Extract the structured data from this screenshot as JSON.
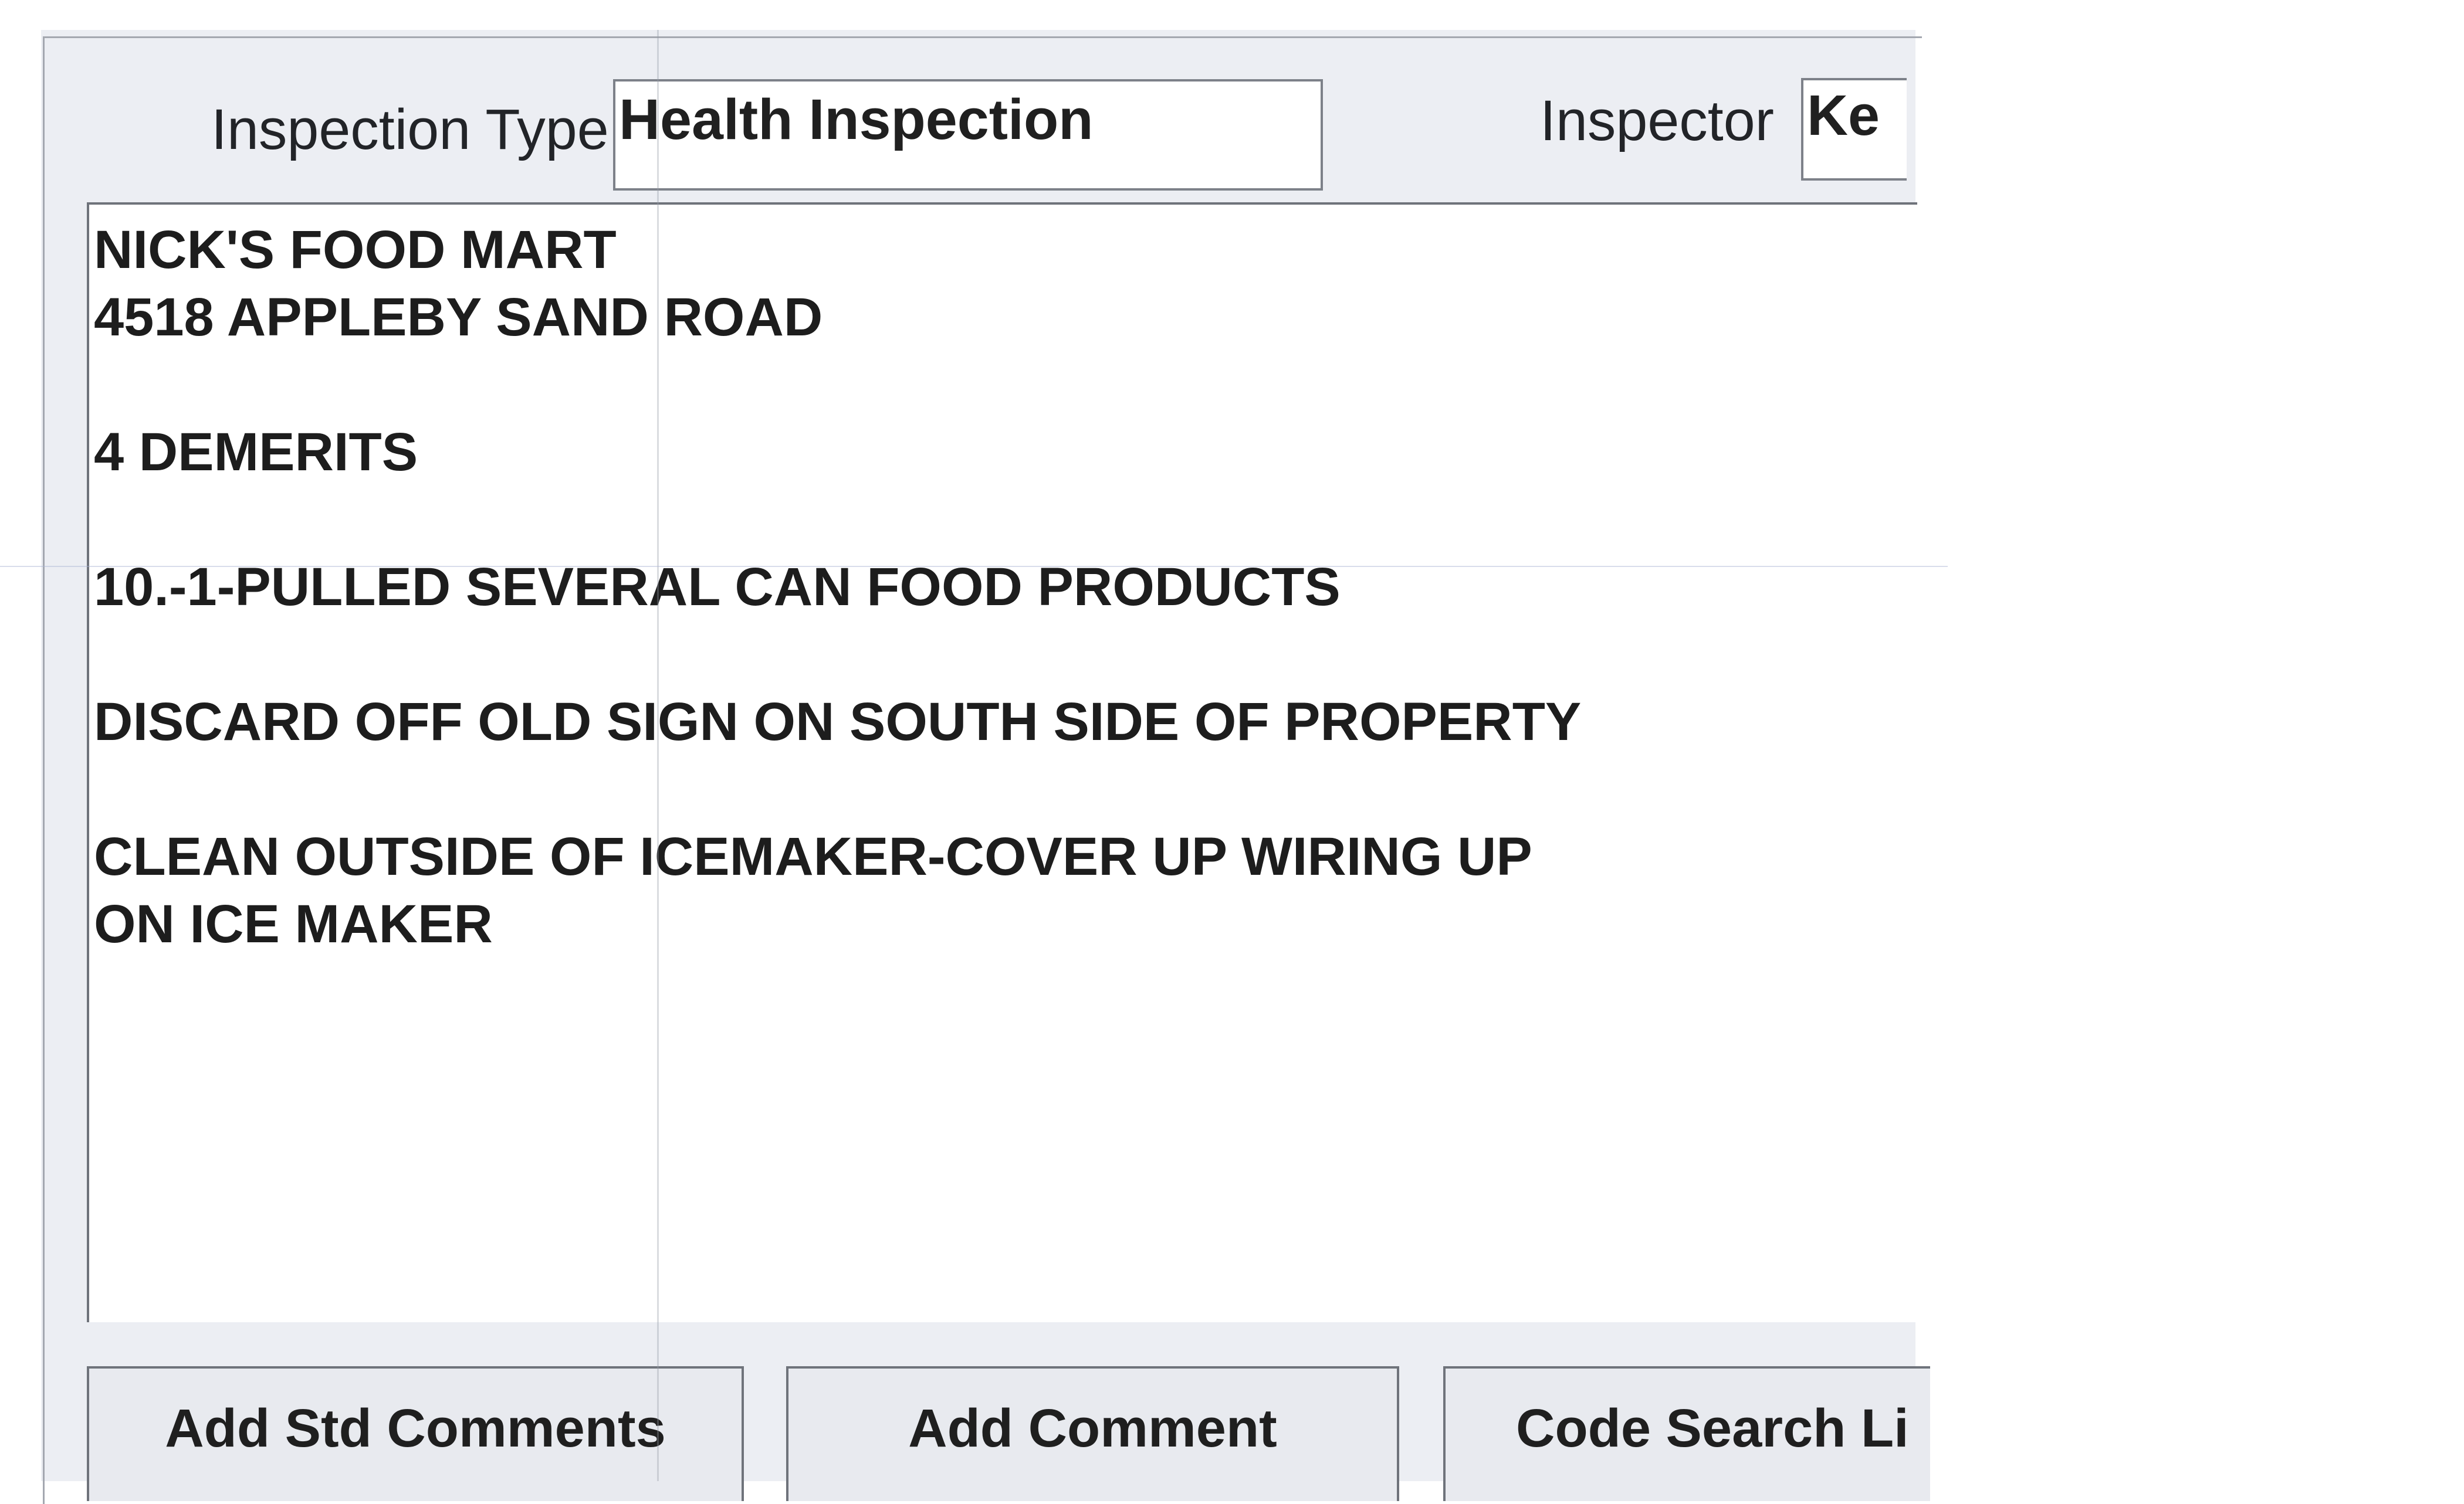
{
  "header": {
    "inspection_type_label": "Inspection Type",
    "inspection_type_value": "Health Inspection",
    "inspector_label": "Inspector",
    "inspector_value": "Ke"
  },
  "comments": {
    "lines": [
      "NICK'S FOOD MART",
      "4518 APPLEBY SAND ROAD",
      "",
      "4 DEMERITS",
      "",
      "10.-1-PULLED SEVERAL CAN FOOD PRODUCTS",
      "",
      "DISCARD OFF OLD SIGN ON SOUTH SIDE OF PROPERTY",
      "",
      "CLEAN OUTSIDE OF ICEMAKER-COVER UP WIRING UP",
      "ON ICE MAKER"
    ]
  },
  "buttons": {
    "add_std_comments": "Add Std Comments",
    "add_comment": "Add Comment",
    "code_search": "Code Search Li"
  }
}
